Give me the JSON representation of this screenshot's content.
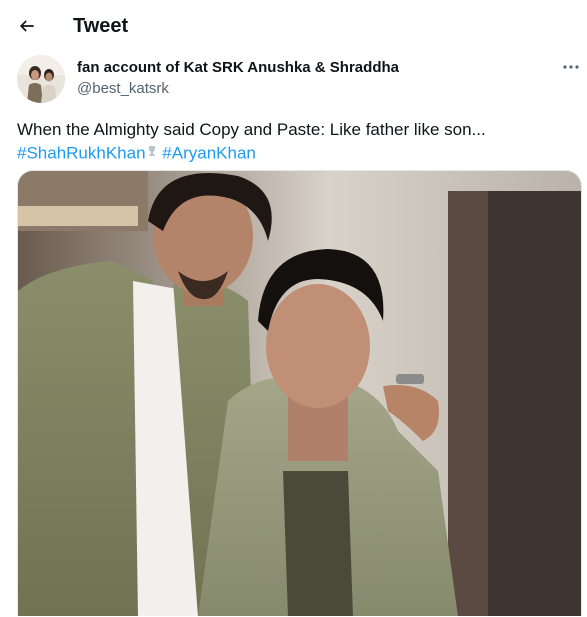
{
  "header": {
    "title": "Tweet"
  },
  "author": {
    "display_name": "fan account of Kat SRK Anushka & Shraddha",
    "handle": "@best_katsrk"
  },
  "tweet": {
    "text_prefix": "When the Almighty said Copy and Paste: Like father like son...",
    "hashtag_1": "#ShahRukhKhan",
    "hashtag_2": "#AryanKhan"
  },
  "icons": {
    "back": "arrow-left-icon",
    "more": "more-horizontal-icon",
    "emoji": "trophy-emoji-icon"
  },
  "colors": {
    "text": "#0f1419",
    "secondary": "#536471",
    "link": "#1d9bf0"
  }
}
